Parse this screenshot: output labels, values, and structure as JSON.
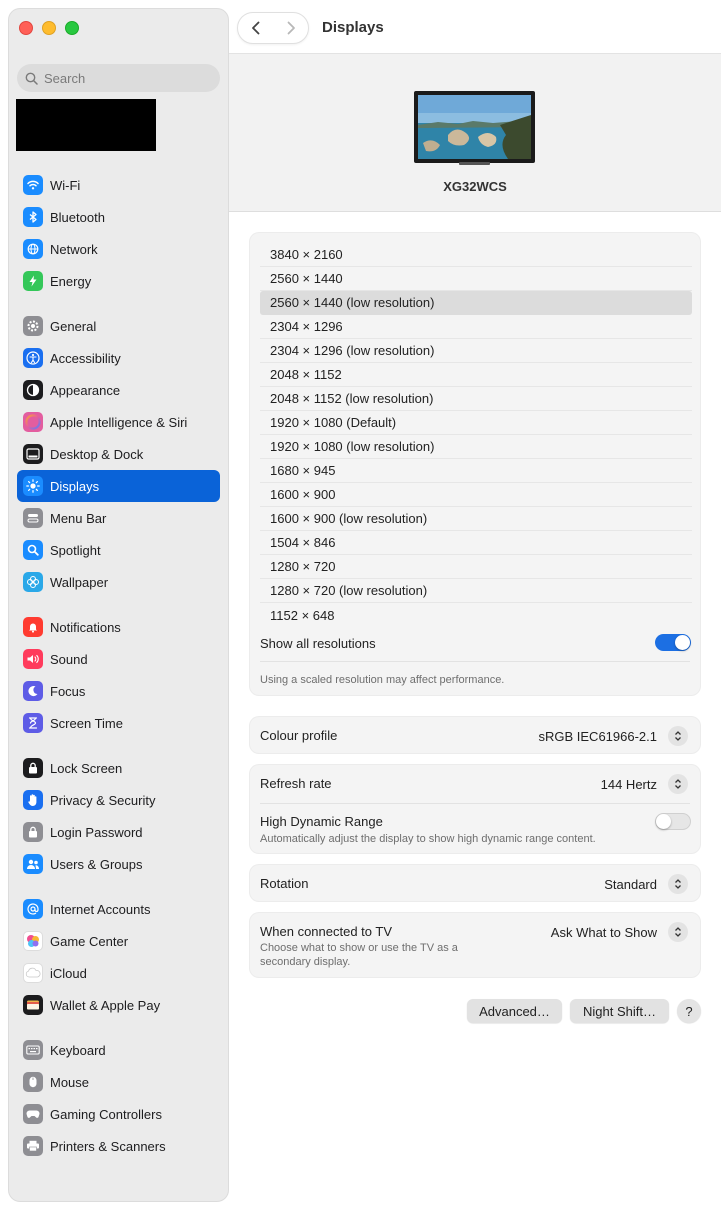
{
  "window": {
    "title": "Displays"
  },
  "search": {
    "placeholder": "Search"
  },
  "sidebar": {
    "items": [
      {
        "label": "Wi-Fi",
        "icon": "wifi-icon",
        "color": "#1a8cff"
      },
      {
        "label": "Bluetooth",
        "icon": "bluetooth-icon",
        "color": "#1a8cff"
      },
      {
        "label": "Network",
        "icon": "globe-icon",
        "color": "#1a8cff"
      },
      {
        "label": "Energy",
        "icon": "energy-icon",
        "color": "#34c759"
      },
      {
        "label": "General",
        "icon": "gear-icon",
        "color": "#8e8e93"
      },
      {
        "label": "Accessibility",
        "icon": "accessibility-icon",
        "color": "#1a6ff0"
      },
      {
        "label": "Appearance",
        "icon": "appearance-icon",
        "color": "#1c1c1e"
      },
      {
        "label": "Apple Intelligence & Siri",
        "icon": "siri-icon",
        "color": "#e35d9f"
      },
      {
        "label": "Desktop & Dock",
        "icon": "dock-icon",
        "color": "#1c1c1e"
      },
      {
        "label": "Displays",
        "icon": "sun-icon",
        "color": "#1a8cff"
      },
      {
        "label": "Menu Bar",
        "icon": "menu-bar-icon",
        "color": "#8e8e93"
      },
      {
        "label": "Spotlight",
        "icon": "magnifier-icon",
        "color": "#1a8cff"
      },
      {
        "label": "Wallpaper",
        "icon": "flower-icon",
        "color": "#2aa8e8"
      },
      {
        "label": "Notifications",
        "icon": "bell-icon",
        "color": "#ff3b30"
      },
      {
        "label": "Sound",
        "icon": "speaker-icon",
        "color": "#ff3b5c"
      },
      {
        "label": "Focus",
        "icon": "moon-icon",
        "color": "#5e5ce6"
      },
      {
        "label": "Screen Time",
        "icon": "hourglass-icon",
        "color": "#5e5ce6"
      },
      {
        "label": "Lock Screen",
        "icon": "lock-icon",
        "color": "#1c1c1e"
      },
      {
        "label": "Privacy & Security",
        "icon": "hand-icon",
        "color": "#1a6ff0"
      },
      {
        "label": "Login Password",
        "icon": "padlock-icon",
        "color": "#8e8e93"
      },
      {
        "label": "Users & Groups",
        "icon": "users-icon",
        "color": "#1a8cff"
      },
      {
        "label": "Internet Accounts",
        "icon": "at-icon",
        "color": "#1a8cff"
      },
      {
        "label": "Game Center",
        "icon": "game-center-icon",
        "color": "#ffffff"
      },
      {
        "label": "iCloud",
        "icon": "cloud-icon",
        "color": "#ffffff"
      },
      {
        "label": "Wallet & Apple Pay",
        "icon": "wallet-icon",
        "color": "#1c1c1e"
      },
      {
        "label": "Keyboard",
        "icon": "keyboard-icon",
        "color": "#8e8e93"
      },
      {
        "label": "Mouse",
        "icon": "mouse-icon",
        "color": "#8e8e93"
      },
      {
        "label": "Gaming Controllers",
        "icon": "gamepad-icon",
        "color": "#8e8e93"
      },
      {
        "label": "Printers & Scanners",
        "icon": "printer-icon",
        "color": "#8e8e93"
      }
    ],
    "active": "Displays"
  },
  "display": {
    "name": "XG32WCS"
  },
  "resolutions": {
    "items": [
      "3840 × 2160",
      "2560 × 1440",
      "2560 × 1440 (low resolution)",
      "2304 × 1296",
      "2304 × 1296 (low resolution)",
      "2048 × 1152",
      "2048 × 1152 (low resolution)",
      "1920 × 1080 (Default)",
      "1920 × 1080 (low resolution)",
      "1680 × 945",
      "1600 × 900",
      "1600 × 900 (low resolution)",
      "1504 × 846",
      "1280 × 720",
      "1280 × 720 (low resolution)",
      "1152 × 648"
    ],
    "selected": "2560 × 1440 (low resolution)",
    "show_all_label": "Show all resolutions",
    "show_all_on": true,
    "note": "Using a scaled resolution may affect performance."
  },
  "colour_profile": {
    "label": "Colour profile",
    "value": "sRGB IEC61966-2.1"
  },
  "refresh": {
    "label": "Refresh rate",
    "value": "144 Hertz"
  },
  "hdr": {
    "label": "High Dynamic Range",
    "description": "Automatically adjust the display to show high dynamic range content.",
    "on": false
  },
  "rotation": {
    "label": "Rotation",
    "value": "Standard"
  },
  "tv": {
    "label": "When connected to TV",
    "description": "Choose what to show or use the TV as a secondary display.",
    "value": "Ask What to Show"
  },
  "buttons": {
    "advanced": "Advanced…",
    "night_shift": "Night Shift…",
    "help": "?"
  },
  "colors": {
    "accent": "#0a63d8",
    "toggle_on": "#1c6fe3"
  }
}
